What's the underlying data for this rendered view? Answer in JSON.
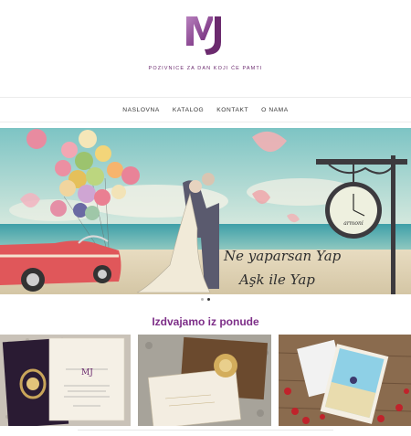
{
  "brand": {
    "logo_text": "MJ",
    "tagline": "POZIVNICE ZA DAN KOJI ĆE PAMTI",
    "accent": "#7d2e88",
    "accent_light": "#c78fc7"
  },
  "nav": {
    "items": [
      {
        "label": "NASLOVNA"
      },
      {
        "label": "KATALOG"
      },
      {
        "label": "KONTAKT"
      },
      {
        "label": "O NAMA"
      }
    ]
  },
  "hero": {
    "line1": "Ne yaparsan Yap",
    "line2": "Aşk ile Yap",
    "clock_brand": "armoni",
    "slides": 2,
    "active_slide": 2
  },
  "featured": {
    "title": "Izdvajamo iz ponude",
    "cards": [
      {
        "alt": "purple-invitation-with-gold-seal"
      },
      {
        "alt": "brown-envelope-invitation-with-gold-ornament"
      },
      {
        "alt": "beach-couple-illustrated-invitation"
      }
    ],
    "card1_monogram": "MJ"
  }
}
